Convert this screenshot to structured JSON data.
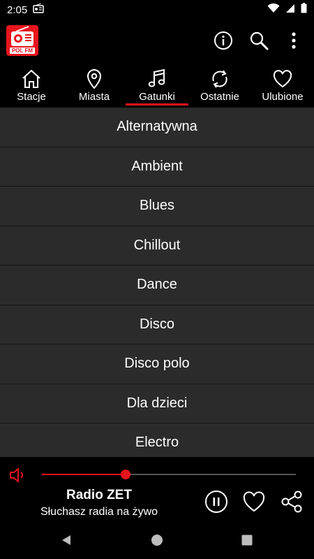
{
  "status": {
    "time": "2:05"
  },
  "app": {
    "logo_text": "POL FM",
    "accent_color": "#e8141c",
    "actions": [
      {
        "name": "info-icon"
      },
      {
        "name": "search-icon"
      },
      {
        "name": "more-vert-icon"
      }
    ]
  },
  "tabs": [
    {
      "label": "Stacje",
      "icon": "home-icon",
      "selected": false
    },
    {
      "label": "Miasta",
      "icon": "location-pin-icon",
      "selected": false
    },
    {
      "label": "Gatunki",
      "icon": "music-note-icon",
      "selected": true
    },
    {
      "label": "Ostatnie",
      "icon": "refresh-icon",
      "selected": false
    },
    {
      "label": "Ulubione",
      "icon": "heart-icon",
      "selected": false
    }
  ],
  "genres": [
    "Alternatywna",
    "Ambient",
    "Blues",
    "Chillout",
    "Dance",
    "Disco",
    "Disco polo",
    "Dla dzieci",
    "Electro"
  ],
  "player": {
    "station_name": "Radio ZET",
    "subtitle": "Słuchasz radia na żywo",
    "volume_fraction": 0.33,
    "state": "playing"
  }
}
